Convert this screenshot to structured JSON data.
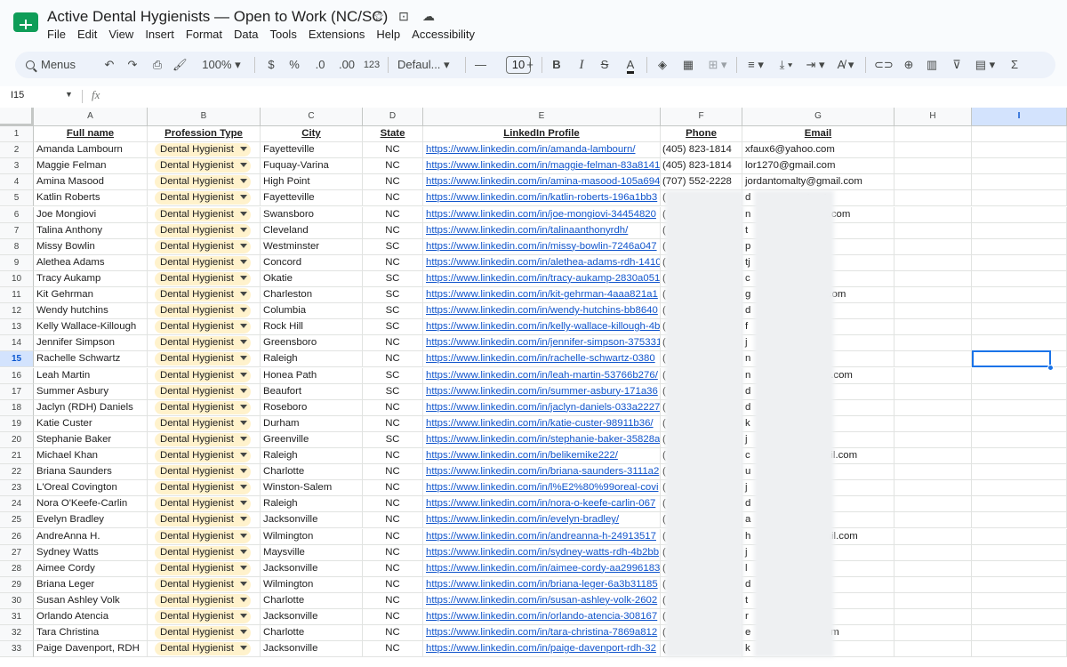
{
  "window": {
    "title": "Active Dental Hygienists — Open to Work (NC/SC)",
    "title_icons": [
      "star-icon",
      "move-to-folder-icon",
      "cloud-status-icon"
    ]
  },
  "menu": [
    "File",
    "Edit",
    "View",
    "Insert",
    "Format",
    "Data",
    "Tools",
    "Extensions",
    "Help",
    "Accessibility"
  ],
  "toolbar": {
    "menus_label": "Menus",
    "zoom": "100%",
    "currency": "$",
    "percent": "%",
    "dec_decrease": ".0",
    "dec_increase": ".00",
    "number_format": "123",
    "font": "Defaul...",
    "font_size": "10",
    "minus": "—",
    "plus": "+",
    "bold": "B",
    "italic": "I",
    "strike": "S",
    "text_color": "A",
    "sigma": "Σ"
  },
  "formula_bar": {
    "name_box": "I15",
    "fx": "fx",
    "value": ""
  },
  "columns": [
    "A",
    "B",
    "C",
    "D",
    "E",
    "F",
    "G",
    "H",
    "I"
  ],
  "selected_column": "I",
  "selected_row": "15",
  "headers": [
    "Full name",
    "Profession Type",
    "City",
    "State",
    "LinkedIn Profile",
    "Phone",
    "Email"
  ],
  "rows": [
    {
      "n": "2",
      "name": "Amanda Lambourn",
      "type": "Dental Hygienist",
      "city": "Fayetteville",
      "state": "NC",
      "linkedin": "https://www.linkedin.com/in/amanda-lambourn/",
      "phone": "(405) 823-1814",
      "email": "xfaux6@yahoo.com"
    },
    {
      "n": "3",
      "name": "Maggie Felman",
      "type": "Dental Hygienist",
      "city": "Fuquay-Varina",
      "state": "NC",
      "linkedin": "https://www.linkedin.com/in/maggie-felman-83a8141",
      "phone": "(405) 823-1814",
      "email": "lor1270@gmail.com"
    },
    {
      "n": "4",
      "name": "Amina Masood",
      "type": "Dental Hygienist",
      "city": "High Point",
      "state": "NC",
      "linkedin": "https://www.linkedin.com/in/amina-masood-105a694",
      "phone": "(707) 552-2228",
      "email": "jordantomalty@gmail.com"
    },
    {
      "n": "5",
      "name": "Katlin Roberts",
      "type": "Dental Hygienist",
      "city": "Fayetteville",
      "state": "NC",
      "linkedin": "https://www.linkedin.com/in/katlin-roberts-196a1bb3",
      "phone": "(",
      "email": "d                    t.net"
    },
    {
      "n": "6",
      "name": "Joe Mongiovi",
      "type": "Dental Hygienist",
      "city": "Swansboro",
      "state": "NC",
      "linkedin": "https://www.linkedin.com/in/joe-mongiovi-34454820",
      "phone": "(",
      "email": "n                  otmail.com"
    },
    {
      "n": "7",
      "name": "Talina Anthony",
      "type": "Dental Hygienist",
      "city": "Cleveland",
      "state": "NC",
      "linkedin": "https://www.linkedin.com/in/talinaanthonyrdh/",
      "phone": "(",
      "email": "t                   n"
    },
    {
      "n": "8",
      "name": "Missy Bowlin",
      "type": "Dental Hygienist",
      "city": "Westminster",
      "state": "SC",
      "linkedin": "https://www.linkedin.com/in/missy-bowlin-7246a047",
      "phone": "(",
      "email": "p                  l.com"
    },
    {
      "n": "9",
      "name": "Alethea Adams",
      "type": "Dental Hygienist",
      "city": "Concord",
      "state": "NC",
      "linkedin": "https://www.linkedin.com/in/alethea-adams-rdh-1410",
      "phone": "(",
      "email": "tj"
    },
    {
      "n": "10",
      "name": "Tracy Aukamp",
      "type": "Dental Hygienist",
      "city": "Okatie",
      "state": "SC",
      "linkedin": "https://www.linkedin.com/in/tracy-aukamp-2830a051",
      "phone": "(",
      "email": "c                  .com"
    },
    {
      "n": "11",
      "name": "Kit Gehrman",
      "type": "Dental Hygienist",
      "city": "Charleston",
      "state": "SC",
      "linkedin": "https://www.linkedin.com/in/kit-gehrman-4aaa821a1",
      "phone": "(",
      "email": "g                  ahoo.com"
    },
    {
      "n": "12",
      "name": "Wendy hutchins",
      "type": "Dental Hygienist",
      "city": "Columbia",
      "state": "SC",
      "linkedin": "https://www.linkedin.com/in/wendy-hutchins-bb8640",
      "phone": "(",
      "email": "d                  il.com"
    },
    {
      "n": "13",
      "name": "Kelly Wallace-Killough",
      "type": "Dental Hygienist",
      "city": "Rock Hill",
      "state": "SC",
      "linkedin": "https://www.linkedin.com/in/kelly-wallace-killough-4b",
      "phone": "(",
      "email": "f                  ail.com"
    },
    {
      "n": "14",
      "name": "Jennifer Simpson",
      "type": "Dental Hygienist",
      "city": "Greensboro",
      "state": "NC",
      "linkedin": "https://www.linkedin.com/in/jennifer-simpson-375331",
      "phone": "(",
      "email": "j"
    },
    {
      "n": "15",
      "name": "Rachelle Schwartz",
      "type": "Dental Hygienist",
      "city": "Raleigh",
      "state": "NC",
      "linkedin": "https://www.linkedin.com/in/rachelle-schwartz-0380",
      "phone": "(",
      "email": "n                  com"
    },
    {
      "n": "16",
      "name": "Leah Martin",
      "type": "Dental Hygienist",
      "city": "Honea Path",
      "state": "SC",
      "linkedin": "https://www.linkedin.com/in/leah-martin-53766b276/",
      "phone": "(",
      "email": "n                  capital.com"
    },
    {
      "n": "17",
      "name": "Summer Asbury",
      "type": "Dental Hygienist",
      "city": "Beaufort",
      "state": "SC",
      "linkedin": "https://www.linkedin.com/in/summer-asbury-171a36",
      "phone": "(",
      "email": "d                  com"
    },
    {
      "n": "18",
      "name": "Jaclyn (RDH) Daniels",
      "type": "Dental Hygienist",
      "city": "Roseboro",
      "state": "NC",
      "linkedin": "https://www.linkedin.com/in/jaclyn-daniels-033a2227",
      "phone": "(",
      "email": "d                  om"
    },
    {
      "n": "19",
      "name": "Katie Custer",
      "type": "Dental Hygienist",
      "city": "Durham",
      "state": "NC",
      "linkedin": "https://www.linkedin.com/in/katie-custer-98911b36/",
      "phone": "(",
      "email": "k                  m"
    },
    {
      "n": "20",
      "name": "Stephanie Baker",
      "type": "Dental Hygienist",
      "city": "Greenville",
      "state": "SC",
      "linkedin": "https://www.linkedin.com/in/stephanie-baker-35828a",
      "phone": "(",
      "email": "j                  net"
    },
    {
      "n": "21",
      "name": "Michael Khan",
      "type": "Dental Hygienist",
      "city": "Raleigh",
      "state": "NC",
      "linkedin": "https://www.linkedin.com/in/belikemike222/",
      "phone": "(",
      "email": "c                  @gmail.com"
    },
    {
      "n": "22",
      "name": "Briana Saunders",
      "type": "Dental Hygienist",
      "city": "Charlotte",
      "state": "NC",
      "linkedin": "https://www.linkedin.com/in/briana-saunders-3111a2",
      "phone": "(",
      "email": "u"
    },
    {
      "n": "23",
      "name": "L'Oreal Covington",
      "type": "Dental Hygienist",
      "city": "Winston-Salem",
      "state": "NC",
      "linkedin": "https://www.linkedin.com/in/l%E2%80%99oreal-covi",
      "phone": "(",
      "email": "j                  om"
    },
    {
      "n": "24",
      "name": "Nora O'Keefe-Carlin",
      "type": "Dental Hygienist",
      "city": "Raleigh",
      "state": "NC",
      "linkedin": "https://www.linkedin.com/in/nora-o-keefe-carlin-067",
      "phone": "(",
      "email": "d                  com"
    },
    {
      "n": "25",
      "name": "Evelyn Bradley",
      "type": "Dental Hygienist",
      "city": "Jacksonville",
      "state": "NC",
      "linkedin": "https://www.linkedin.com/in/evelyn-bradley/",
      "phone": "(",
      "email": "a                  com"
    },
    {
      "n": "26",
      "name": "AndreAnna H.",
      "type": "Dental Hygienist",
      "city": "Wilmington",
      "state": "NC",
      "linkedin": "https://www.linkedin.com/in/andreanna-h-24913517",
      "phone": "(",
      "email": "h                  @gmail.com"
    },
    {
      "n": "27",
      "name": "Sydney Watts",
      "type": "Dental Hygienist",
      "city": "Maysville",
      "state": "NC",
      "linkedin": "https://www.linkedin.com/in/sydney-watts-rdh-4b2bb",
      "phone": "(",
      "email": "j                  ail.com"
    },
    {
      "n": "28",
      "name": "Aimee Cordy",
      "type": "Dental Hygienist",
      "city": "Jacksonville",
      "state": "NC",
      "linkedin": "https://www.linkedin.com/in/aimee-cordy-aa2996183",
      "phone": "(",
      "email": "l"
    },
    {
      "n": "29",
      "name": "Briana Leger",
      "type": "Dental Hygienist",
      "city": "Wilmington",
      "state": "NC",
      "linkedin": "https://www.linkedin.com/in/briana-leger-6a3b31185",
      "phone": "(",
      "email": "d                  .net"
    },
    {
      "n": "30",
      "name": "Susan Ashley Volk",
      "type": "Dental Hygienist",
      "city": "Charlotte",
      "state": "NC",
      "linkedin": "https://www.linkedin.com/in/susan-ashley-volk-2602",
      "phone": "(",
      "email": "t                  il.com"
    },
    {
      "n": "31",
      "name": "Orlando Atencia",
      "type": "Dental Hygienist",
      "city": "Jacksonville",
      "state": "NC",
      "linkedin": "https://www.linkedin.com/in/orlando-atencia-308167",
      "phone": "(",
      "email": "r                  il.com"
    },
    {
      "n": "32",
      "name": "Tara Christina",
      "type": "Dental Hygienist",
      "city": "Charlotte",
      "state": "NC",
      "linkedin": "https://www.linkedin.com/in/tara-christina-7869a812",
      "phone": "(",
      "email": "e                  nail.com"
    },
    {
      "n": "33",
      "name": "Paige Davenport, RDH",
      "type": "Dental Hygienist",
      "city": "Jacksonville",
      "state": "NC",
      "linkedin": "https://www.linkedin.com/in/paige-davenport-rdh-32",
      "phone": "(",
      "email": "k                  com"
    }
  ],
  "colors": {
    "link": "#1155cc",
    "chip": "#fff2cc",
    "selection": "#1a73e8",
    "header_selected": "#d3e3fd"
  }
}
